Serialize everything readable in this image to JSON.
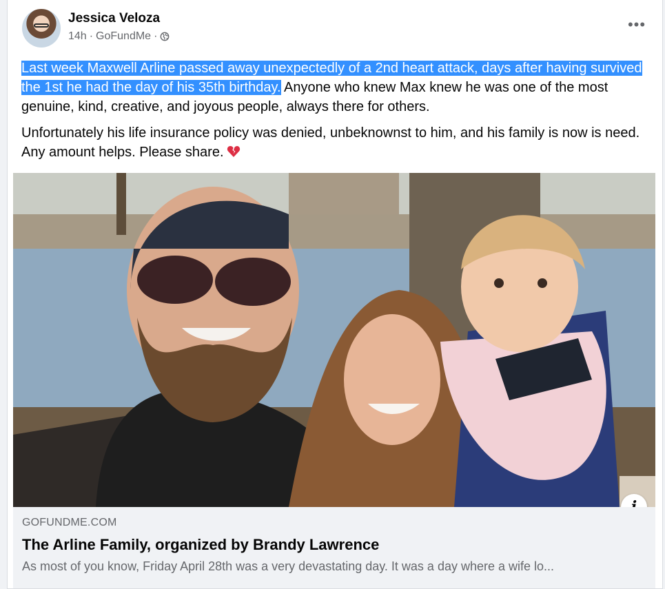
{
  "post": {
    "author": "Jessica Veloza",
    "time": "14h",
    "separator": "·",
    "source": "GoFundMe",
    "separator2": "·",
    "privacy_icon": "globe-icon",
    "more_icon": "•••",
    "text": {
      "highlighted": "Last week Maxwell Arline passed away unexpectedly of a 2nd heart attack, days after having survived the 1st he had the day of his 35th birthday.",
      "rest": " Anyone who knew Max knew he was one of the most genuine, kind, creative, and joyous people, always there for others.",
      "paragraph2": "Unfortunately his life insurance policy was denied, unbeknownst to him, and his family is now is need. Any amount helps. Please share."
    },
    "emoji": "broken-heart-icon"
  },
  "link": {
    "domain": "GOFUNDME.COM",
    "title": "The Arline Family, organized by Brandy Lawrence",
    "description": "As most of you know, Friday April 28th was a very devastating day. It was a day where a wife lo...",
    "info_label": "i"
  },
  "colors": {
    "highlight": "#3390ff",
    "link_bg": "#f0f2f5",
    "muted": "#65676b"
  }
}
